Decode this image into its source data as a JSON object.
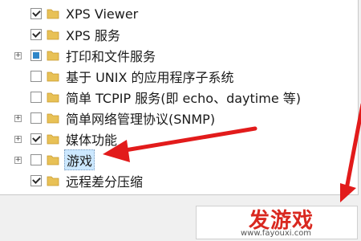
{
  "tree": {
    "items": [
      {
        "label": "XPS Viewer",
        "state": "checked",
        "expandable": false
      },
      {
        "label": "XPS 服务",
        "state": "checked",
        "expandable": false
      },
      {
        "label": "打印和文件服务",
        "state": "partial",
        "expandable": true
      },
      {
        "label": "基于 UNIX 的应用程序子系统",
        "state": "unchecked",
        "expandable": false
      },
      {
        "label": "简单 TCPIP 服务(即 echo、daytime 等)",
        "state": "unchecked",
        "expandable": false
      },
      {
        "label": "简单网络管理协议(SNMP)",
        "state": "unchecked",
        "expandable": true
      },
      {
        "label": "媒体功能",
        "state": "checked",
        "expandable": true
      },
      {
        "label": "游戏",
        "state": "unchecked",
        "expandable": true,
        "selected": true
      },
      {
        "label": "远程差分压缩",
        "state": "checked",
        "expandable": false
      }
    ]
  },
  "watermark": {
    "brand": "发游戏",
    "url": "www.fayouxi.com"
  },
  "colors": {
    "arrow": "#e21b1b",
    "folder": "#e8c156",
    "selection": "#cce8ff"
  }
}
